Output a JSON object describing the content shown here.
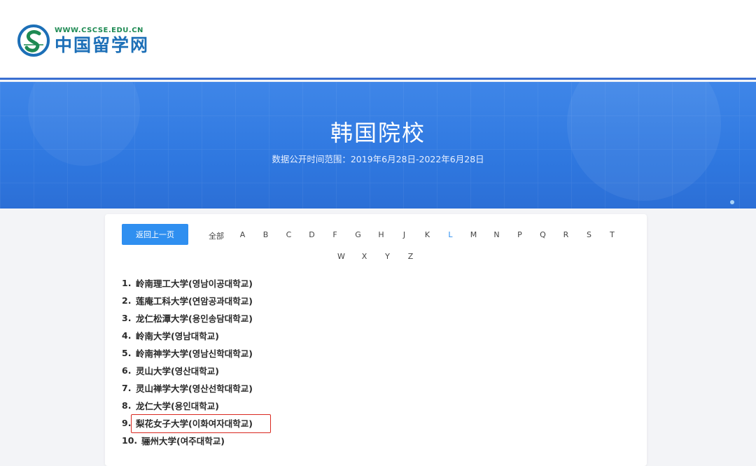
{
  "header": {
    "logo_url": "WWW.CSCSE.EDU.CN",
    "logo_name": "中国留学网"
  },
  "banner": {
    "title": "韩国院校",
    "subtitle": "数据公开时间范围：2019年6月28日-2022年6月28日"
  },
  "nav": {
    "back_label": "返回上一页",
    "letters_row1": [
      "全部",
      "A",
      "B",
      "C",
      "D",
      "F",
      "G",
      "H",
      "J",
      "K",
      "L",
      "M",
      "N",
      "P",
      "Q",
      "R",
      "S",
      "T"
    ],
    "letters_row2": [
      "W",
      "X",
      "Y",
      "Z"
    ],
    "active_letter": "L"
  },
  "universities": [
    {
      "num": "1.",
      "name": "岭南理工大学(영남이공대학교)"
    },
    {
      "num": "2.",
      "name": "莲庵工科大学(연암공과대학교)"
    },
    {
      "num": "3.",
      "name": "龙仁松潭大学(용인송담대학교)"
    },
    {
      "num": "4.",
      "name": "岭南大学(영남대학교)"
    },
    {
      "num": "5.",
      "name": "岭南神学大学(영남신학대학교)"
    },
    {
      "num": "6.",
      "name": "灵山大学(영산대학교)"
    },
    {
      "num": "7.",
      "name": "灵山禅学大学(영산선학대학교)"
    },
    {
      "num": "8.",
      "name": "龙仁大学(용인대학교)"
    },
    {
      "num": "9.",
      "name": "梨花女子大学(이화여자대학교)"
    },
    {
      "num": "10.",
      "name": "骊州大学(여주대학교)"
    }
  ],
  "highlighted_index": 8,
  "colors": {
    "accent": "#2f8ff0",
    "banner": "#2f78e0",
    "highlight": "#d9281f",
    "logo_green": "#1e8a53",
    "logo_blue": "#1c6fb7"
  }
}
